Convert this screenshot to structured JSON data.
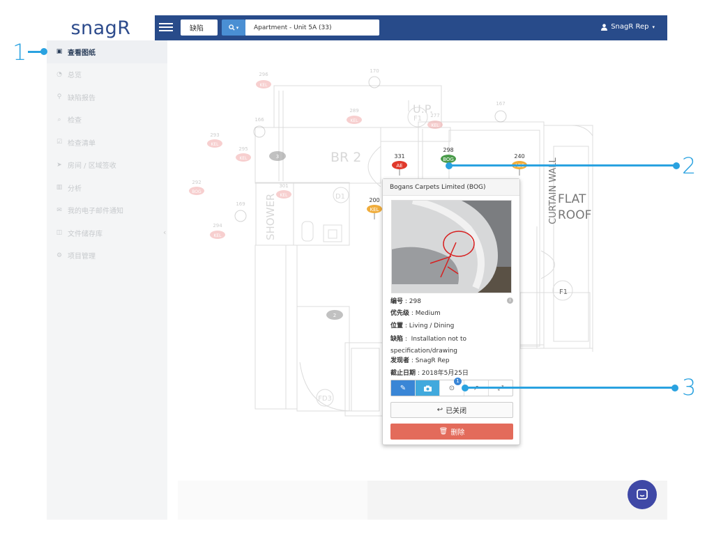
{
  "app": {
    "logo_text": "snagR",
    "brand_color": "#284b8a"
  },
  "topbar": {
    "type_value": "缺陷",
    "search_icon": "search-icon",
    "project_value": "Apartment - Unit 5A (33)",
    "user_label": "SnagR Rep"
  },
  "sidebar": {
    "items": [
      {
        "label": "查看图纸",
        "icon": "image-icon",
        "active": true
      },
      {
        "label": "总览",
        "icon": "dashboard-icon",
        "active": false
      },
      {
        "label": "缺陷报告",
        "icon": "map-marker-icon",
        "active": false
      },
      {
        "label": "检查",
        "icon": "search-icon",
        "active": false
      },
      {
        "label": "检查清单",
        "icon": "checklist-icon",
        "active": false
      },
      {
        "label": "房间 / 区域签收",
        "icon": "send-icon",
        "active": false
      },
      {
        "label": "分析",
        "icon": "bar-chart-icon",
        "active": false
      },
      {
        "label": "我的电子邮件通知",
        "icon": "envelope-icon",
        "active": false
      },
      {
        "label": "文件储存库",
        "icon": "folder-icon",
        "active": false
      },
      {
        "label": "项目管理",
        "icon": "cogs-icon",
        "active": false
      }
    ]
  },
  "plan": {
    "rooms": {
      "br2": "BR 2",
      "up": "U.P.",
      "shower": "SHOWER",
      "curtain_wall": "CURTAIN WALL",
      "flat": "FLAT",
      "roof": "ROOF"
    },
    "doors": {
      "d1": "D1",
      "f1a": "F1",
      "f1b": "F1",
      "fd3": "FD3"
    },
    "pins": [
      {
        "number": "296",
        "code": "KEL"
      },
      {
        "number": "170",
        "code": ""
      },
      {
        "number": "289",
        "code": "KEL"
      },
      {
        "number": "277",
        "code": "KEL"
      },
      {
        "number": "167",
        "code": ""
      },
      {
        "number": "166",
        "code": ""
      },
      {
        "number": "293",
        "code": "KEL"
      },
      {
        "number": "295",
        "code": "KEL"
      },
      {
        "number": "3",
        "code": ""
      },
      {
        "number": "331",
        "code": "AE"
      },
      {
        "number": "298",
        "code": "BOG"
      },
      {
        "number": "240",
        "code": "ABE"
      },
      {
        "number": "292",
        "code": "BOG"
      },
      {
        "number": "301",
        "code": "KEL"
      },
      {
        "number": "169",
        "code": ""
      },
      {
        "number": "200",
        "code": "KEL"
      },
      {
        "number": "294",
        "code": "KEL"
      },
      {
        "number": "2",
        "code": ""
      }
    ]
  },
  "popup": {
    "title": "Bogans Carpets Limited (BOG)",
    "fields": [
      {
        "label": "编号",
        "value": "298"
      },
      {
        "label": "优先级",
        "value": "Medium"
      },
      {
        "label": "位置",
        "value": "Living / Dining"
      },
      {
        "label": "缺陷",
        "value": "Installation not to specification/drawing"
      },
      {
        "label": "发现者",
        "value": "SnagR Rep"
      },
      {
        "label": "截止日期",
        "value": "2018年5月25日"
      }
    ],
    "history_badge": "1",
    "closed_label": "已关闭",
    "delete_label": "删除"
  },
  "callouts": {
    "one": "1",
    "two": "2",
    "three": "3"
  }
}
